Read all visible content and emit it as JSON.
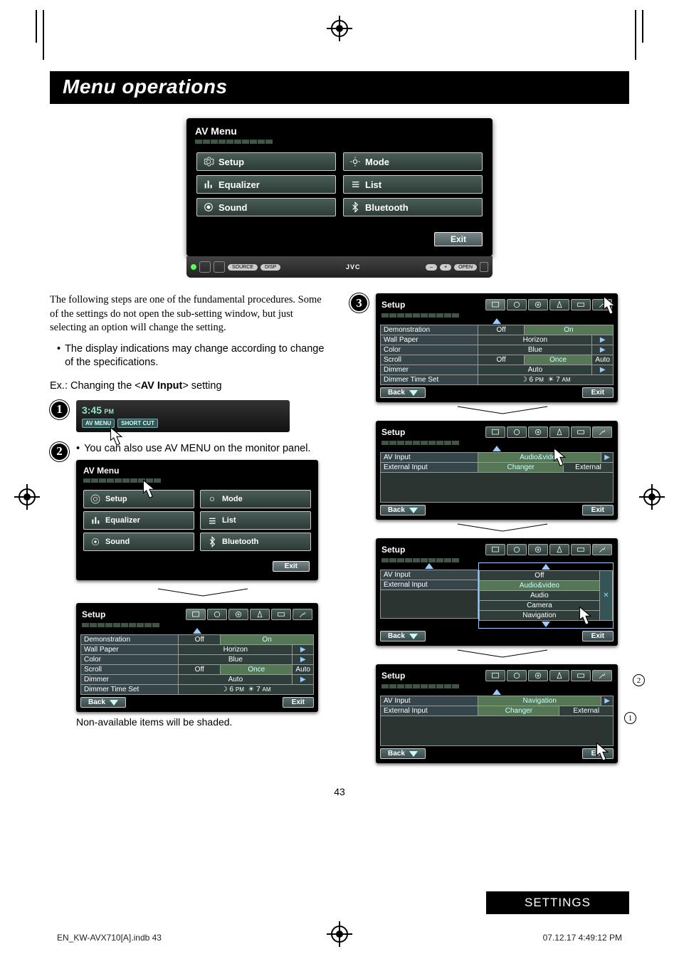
{
  "page": {
    "title": "Menu operations",
    "number": "43",
    "settings_label": "SETTINGS",
    "footer_left": "EN_KW-AVX710[A].indb   43",
    "footer_right": "07.12.17   4:49:12 PM"
  },
  "hero_menu": {
    "title": "AV Menu",
    "items_left": [
      "Setup",
      "Equalizer",
      "Sound"
    ],
    "items_right": [
      "Mode",
      "List",
      "Bluetooth"
    ],
    "exit": "Exit",
    "chin_brand": "JVC",
    "chin_btns": [
      "SOURCE",
      "DISP"
    ],
    "chin_right": "OPEN"
  },
  "intro_para": "The following steps are one of the fundamental procedures. Some of the settings do not open the sub-setting window, but just selecting an option will change the setting.",
  "intro_bullet": "The display indications may change according to change of the specifications.",
  "example_prefix": "Ex.: Changing the <",
  "example_bold": "AV Input",
  "example_suffix": "> setting",
  "step1": {
    "time": "3:45",
    "ampm": "PM",
    "btn_av": "AV MENU",
    "btn_short": "SHORT CUT"
  },
  "step2": {
    "caption_bullet": "You can also use AV MENU on the monitor panel.",
    "av_title": "AV Menu",
    "items_left": [
      "Setup",
      "Equalizer",
      "Sound"
    ],
    "items_right": [
      "Mode",
      "List",
      "Bluetooth"
    ],
    "exit": "Exit"
  },
  "setup_full": {
    "title": "Setup",
    "rows": {
      "demo": {
        "label": "Demonstration",
        "opts": [
          "Off",
          "On"
        ]
      },
      "wall": {
        "label": "Wall Paper",
        "val": "Horizon"
      },
      "color": {
        "label": "Color",
        "val": "Blue"
      },
      "scroll": {
        "label": "Scroll",
        "opts": [
          "Off",
          "Once",
          "Auto"
        ]
      },
      "dimmer": {
        "label": "Dimmer",
        "val": "Auto"
      },
      "dts": {
        "label": "Dimmer Time Set",
        "pm": "6",
        "am": "7",
        "pm_lbl": "PM",
        "am_lbl": "AM"
      }
    },
    "back": "Back",
    "exit": "Exit",
    "note": "Non-available items will be shaded."
  },
  "setup_avinput": {
    "title": "Setup",
    "rows": {
      "av": {
        "label": "AV Input",
        "val": "Audio&video"
      },
      "ext": {
        "label": "External Input",
        "opts": [
          "Changer",
          "External"
        ]
      }
    },
    "back": "Back",
    "exit": "Exit"
  },
  "setup_options": {
    "title": "Setup",
    "rows": {
      "av": {
        "label": "AV Input",
        "cur": "Off",
        "opts": [
          "Audio&video",
          "Audio",
          "Camera",
          "Navigation"
        ]
      },
      "ext": {
        "label": "External Input"
      }
    },
    "back": "Back",
    "exit": "Exit"
  },
  "setup_final": {
    "title": "Setup",
    "rows": {
      "av": {
        "label": "AV Input",
        "val": "Navigation"
      },
      "ext": {
        "label": "External Input",
        "opts": [
          "Changer",
          "External"
        ]
      }
    },
    "back": "Back",
    "exit": "Exit"
  }
}
